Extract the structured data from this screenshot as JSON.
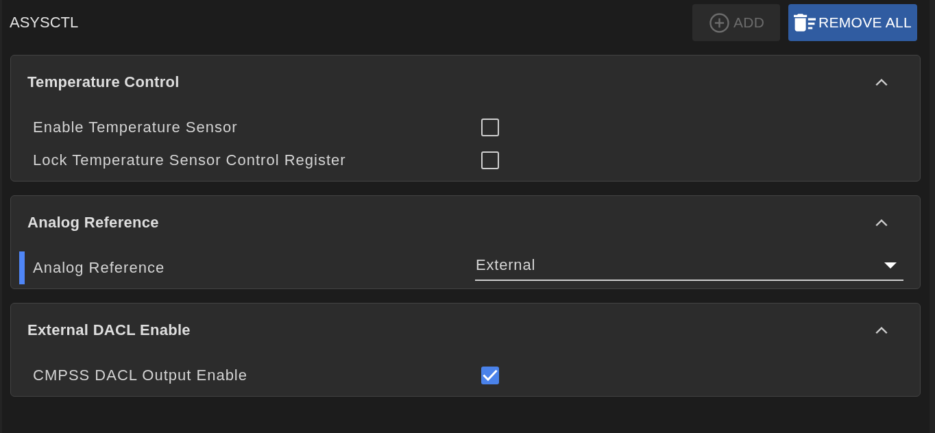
{
  "panel": {
    "title": "ASYSCTL"
  },
  "actions": [
    {
      "kind": "add",
      "label": "ADD",
      "disabled": true
    },
    {
      "kind": "remove",
      "label": "REMOVE ALL",
      "disabled": false
    }
  ],
  "sections": [
    {
      "title": "Temperature Control",
      "expanded": true,
      "fields": [
        {
          "kind": "checkbox",
          "label": "Enable Temperature Sensor",
          "checked": false,
          "modified": false
        },
        {
          "kind": "checkbox",
          "label": "Lock Temperature Sensor Control Register",
          "checked": false,
          "modified": false
        }
      ]
    },
    {
      "title": "Analog Reference",
      "expanded": true,
      "fields": [
        {
          "kind": "select",
          "label": "Analog Reference",
          "value": "External",
          "modified": true
        }
      ]
    },
    {
      "title": "External DACL Enable",
      "expanded": true,
      "fields": [
        {
          "kind": "checkbox",
          "label": "CMPSS DACL Output Enable",
          "checked": true,
          "modified": false
        }
      ]
    }
  ]
}
